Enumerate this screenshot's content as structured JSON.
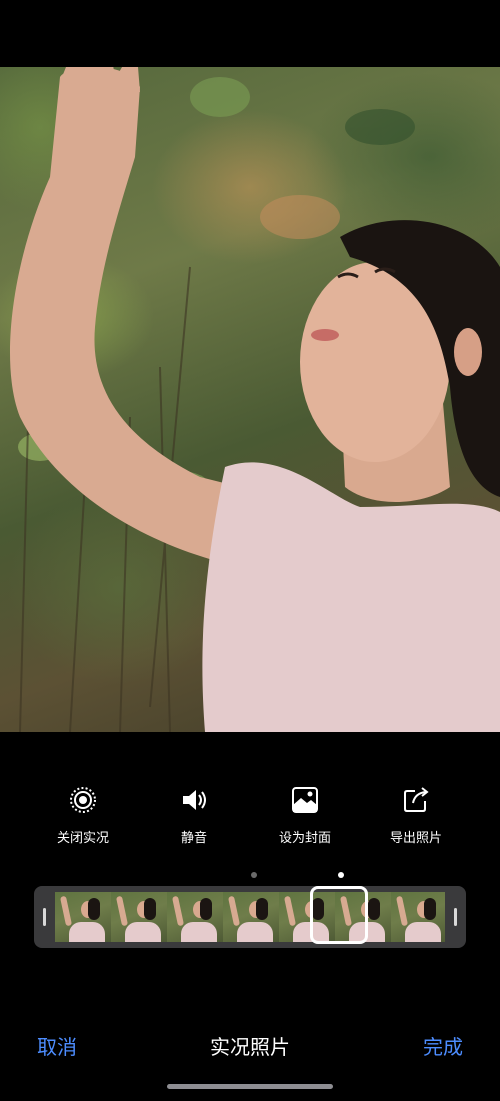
{
  "actions": [
    {
      "label": "关闭实况",
      "icon": "live-photo-icon"
    },
    {
      "label": "静音",
      "icon": "speaker-icon"
    },
    {
      "label": "设为封面",
      "icon": "photo-cover-icon"
    },
    {
      "label": "导出照片",
      "icon": "export-icon"
    }
  ],
  "pager": {
    "count": 2,
    "active_index": 1
  },
  "timeline": {
    "frame_count": 7,
    "selected_frame_index": 5
  },
  "bottom_bar": {
    "cancel_label": "取消",
    "title": "实况照片",
    "done_label": "完成"
  },
  "colors": {
    "accent": "#4d8dff",
    "background": "#000000"
  }
}
